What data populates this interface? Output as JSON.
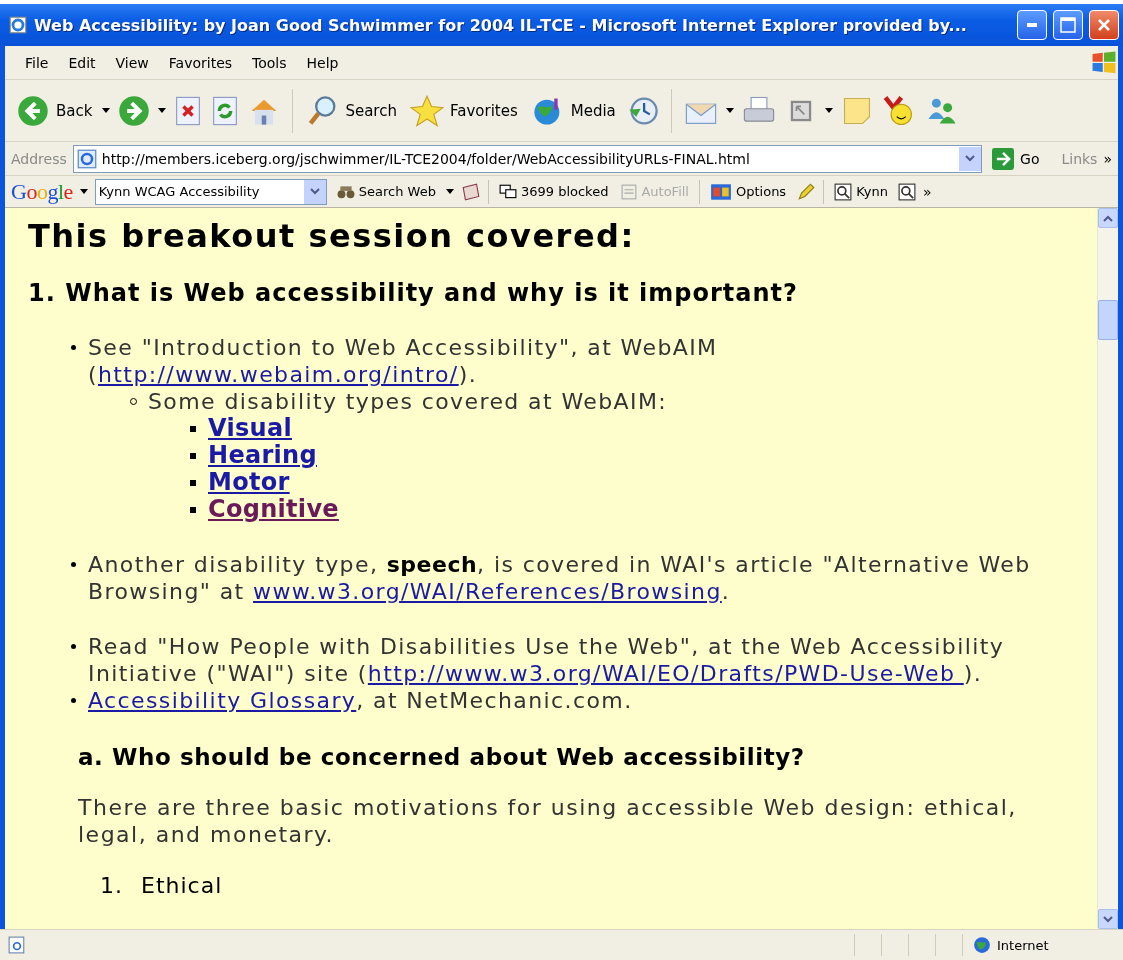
{
  "window": {
    "title": "Web Accessibility: by Joan Good Schwimmer for 2004 IL-TCE - Microsoft Internet Explorer provided by..."
  },
  "menu": [
    "File",
    "Edit",
    "View",
    "Favorites",
    "Tools",
    "Help"
  ],
  "toolbar": {
    "back": "Back",
    "search": "Search",
    "favorites": "Favorites",
    "media": "Media"
  },
  "address_bar": {
    "label": "Address",
    "url": "http://members.iceberg.org/jschwimmer/IL-TCE2004/folder/WebAccessibilityURLs-FINAL.html",
    "go": "Go",
    "links": "Links",
    "more": "»"
  },
  "google_bar": {
    "logo": "Google",
    "search_value": "Kynn WCAG Accessibility",
    "search_web": "Search Web",
    "blocked": "3699 blocked",
    "autofill": {
      "label": "AutoFill",
      "disabled": true
    },
    "options": "Options",
    "kynn": "Kynn",
    "more": "»"
  },
  "content": {
    "heading": "This breakout session covered:",
    "section_heading": "1. What is Web accessibility and why is it important?",
    "lists": [
      [
        {
          "segments": [
            {
              "text": "See \"Introduction to Web Accessibility\", at WebAIM ("
            },
            {
              "link": "http://www.webaim.org/intro/",
              "visited": false
            },
            {
              "text": ")."
            }
          ],
          "children": [
            {
              "segments": [
                {
                  "text": "Some disability types covered at WebAIM:"
                }
              ],
              "children": [
                {
                  "segments": [
                    {
                      "link": "Visual",
                      "visited": false
                    }
                  ]
                },
                {
                  "segments": [
                    {
                      "link": "Hearing",
                      "visited": false
                    }
                  ]
                },
                {
                  "segments": [
                    {
                      "link": "Motor",
                      "visited": false
                    }
                  ]
                },
                {
                  "segments": [
                    {
                      "link": "Cognitive",
                      "visited": true
                    }
                  ]
                }
              ]
            }
          ]
        }
      ],
      [
        {
          "segments": [
            {
              "text": "Another disability type, **speech**, is covered in WAI's article \"Alternative Web Browsing\" at "
            },
            {
              "link": "www.w3.org/WAI/References/Browsing",
              "visited": false
            },
            {
              "text": "."
            }
          ]
        }
      ],
      [
        {
          "segments": [
            {
              "text": "Read \"How People with Disabilities Use the Web\", at the Web Accessibility Initiative (\"WAI\") site ("
            },
            {
              "link": "http://www.w3.org/WAI/EO/Drafts/PWD-Use-Web ",
              "visited": false
            },
            {
              "text": ")."
            }
          ]
        },
        {
          "segments": [
            {
              "link": "Accessibility Glossary",
              "visited": false
            },
            {
              "text": ", at NetMechanic.com."
            }
          ]
        }
      ]
    ],
    "subheading": "a. Who should be concerned about Web accessibility?",
    "paragraph": "There are three basic motivations for using accessible Web design: ethical, legal, and monetary.",
    "ordered": [
      {
        "number": "1.",
        "label": "Ethical"
      }
    ]
  },
  "status_bar": {
    "zone": "Internet"
  }
}
